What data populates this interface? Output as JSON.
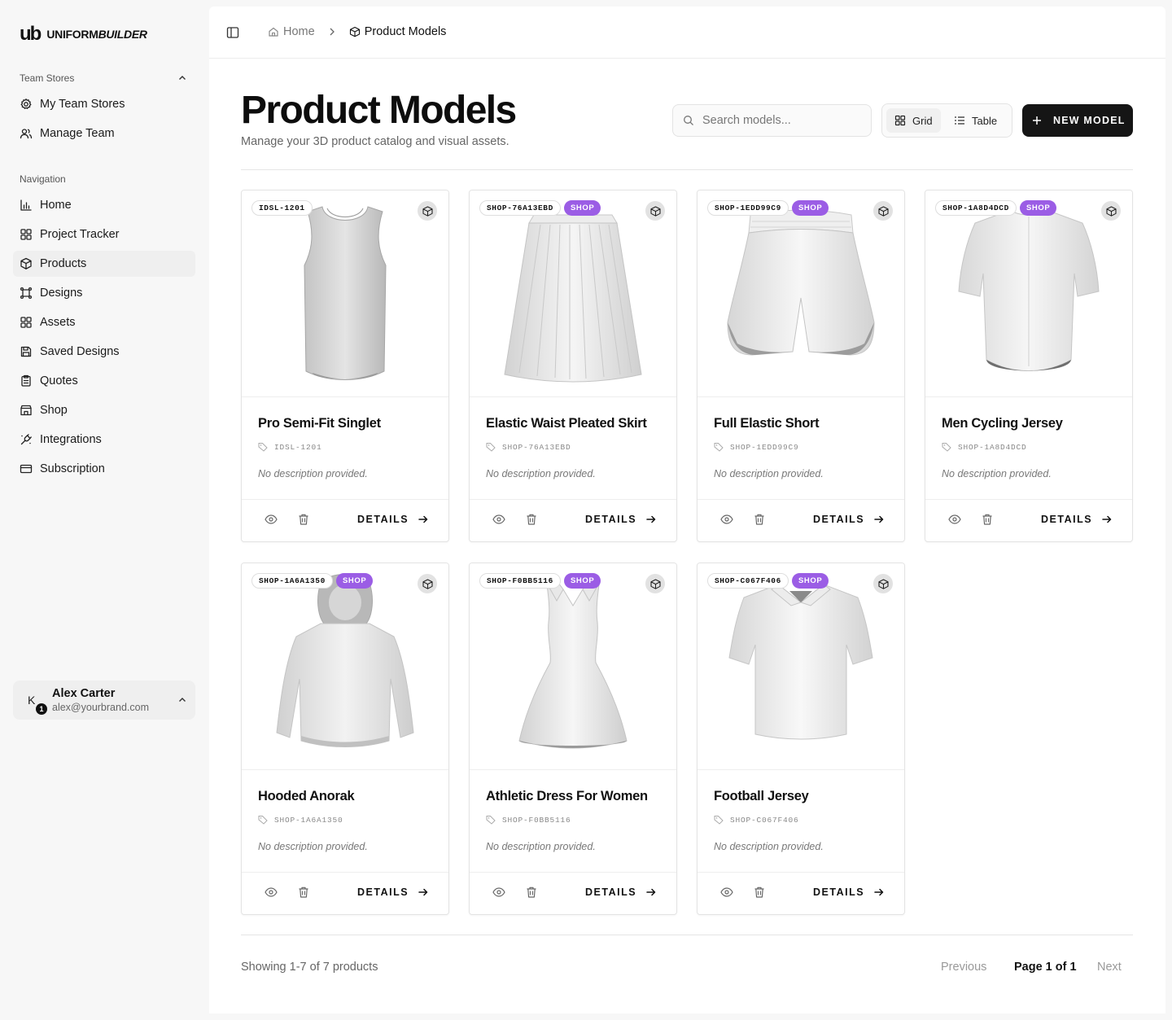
{
  "brand": {
    "mark": "ub",
    "name_main": "UNIFORM",
    "name_italic": "BUILDER"
  },
  "sidebar": {
    "team_stores_label": "Team Stores",
    "team_items": [
      {
        "label": "My Team Stores",
        "icon": "gear-icon"
      },
      {
        "label": "Manage Team",
        "icon": "users-icon"
      }
    ],
    "navigation_label": "Navigation",
    "nav_items": [
      {
        "label": "Home",
        "icon": "bar-chart-icon"
      },
      {
        "label": "Project Tracker",
        "icon": "grid-icon"
      },
      {
        "label": "Products",
        "icon": "box-icon",
        "active": true
      },
      {
        "label": "Designs",
        "icon": "frame-icon"
      },
      {
        "label": "Assets",
        "icon": "grid-icon"
      },
      {
        "label": "Saved Designs",
        "icon": "save-icon"
      },
      {
        "label": "Quotes",
        "icon": "clipboard-icon"
      },
      {
        "label": "Shop",
        "icon": "store-icon"
      },
      {
        "label": "Integrations",
        "icon": "plug-icon"
      },
      {
        "label": "Subscription",
        "icon": "card-icon"
      }
    ],
    "user": {
      "initial": "K",
      "badge": "1",
      "name": "Alex Carter",
      "email": "alex@yourbrand.com"
    }
  },
  "breadcrumb": {
    "home": "Home",
    "current": "Product Models"
  },
  "header": {
    "title": "Product Models",
    "subtitle": "Manage your 3D product catalog and visual assets.",
    "search_placeholder": "Search models...",
    "view_grid": "Grid",
    "view_table": "Table",
    "new_model": "NEW MODEL"
  },
  "products": [
    {
      "sku": "IDSL-1201",
      "shop": false,
      "title": "Pro Semi-Fit Singlet",
      "desc": "No description provided.",
      "garment": "singlet"
    },
    {
      "sku": "SHOP-76A13EBD",
      "shop": true,
      "title": "Elastic Waist Pleated Skirt",
      "desc": "No description provided.",
      "garment": "skirt"
    },
    {
      "sku": "SHOP-1EDD99C9",
      "shop": true,
      "title": "Full Elastic Short",
      "desc": "No description provided.",
      "garment": "shorts"
    },
    {
      "sku": "SHOP-1A8D4DCD",
      "shop": true,
      "title": "Men Cycling Jersey",
      "desc": "No description provided.",
      "garment": "jersey"
    },
    {
      "sku": "SHOP-1A6A1350",
      "shop": true,
      "title": "Hooded Anorak",
      "desc": "No description provided.",
      "garment": "hoodie"
    },
    {
      "sku": "SHOP-F0BB5116",
      "shop": true,
      "title": "Athletic Dress For Women",
      "desc": "No description provided.",
      "garment": "dress"
    },
    {
      "sku": "SHOP-C067F406",
      "shop": true,
      "title": "Football Jersey",
      "desc": "No description provided.",
      "garment": "football"
    }
  ],
  "shop_label": "SHOP",
  "details_label": "DETAILS",
  "footer": {
    "showing": "Showing 1-7 of 7 products",
    "previous": "Previous",
    "page": "Page 1 of 1",
    "next": "Next"
  },
  "colors": {
    "accent": "#9b5de5",
    "primary": "#151515"
  }
}
